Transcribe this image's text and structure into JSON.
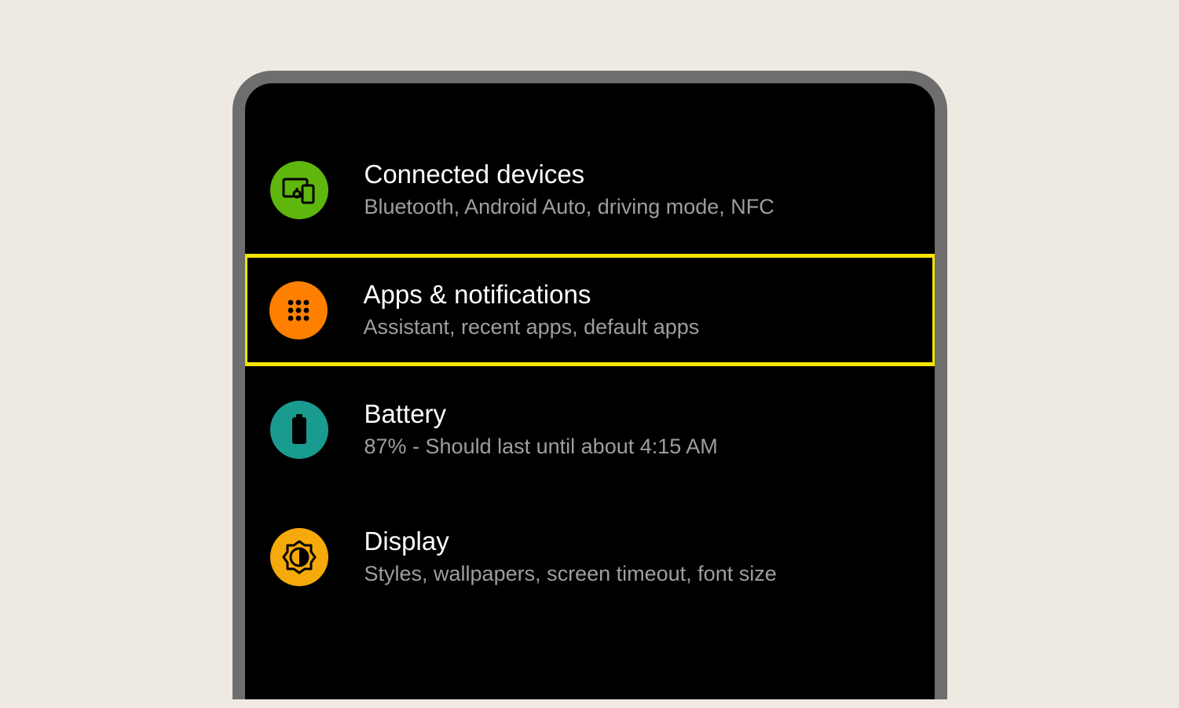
{
  "settings": {
    "items": [
      {
        "key": "connected",
        "title": "Connected devices",
        "subtitle": "Bluetooth, Android Auto, driving mode, NFC",
        "icon": "devices-icon",
        "icon_class": "ic-connected",
        "highlight": false
      },
      {
        "key": "apps",
        "title": "Apps & notifications",
        "subtitle": "Assistant, recent apps, default apps",
        "icon": "apps-grid-icon",
        "icon_class": "ic-apps",
        "highlight": true
      },
      {
        "key": "battery",
        "title": "Battery",
        "subtitle": "87% - Should last until about 4:15 AM",
        "icon": "battery-icon",
        "icon_class": "ic-battery",
        "highlight": false
      },
      {
        "key": "display",
        "title": "Display",
        "subtitle": "Styles, wallpapers, screen timeout, font size",
        "icon": "brightness-icon",
        "icon_class": "ic-display",
        "highlight": false
      }
    ]
  },
  "colors": {
    "page_bg": "#eeeae1",
    "device_frame": "#6e6e6e",
    "device_bg": "#000000",
    "title_text": "#ffffff",
    "subtitle_text": "#9e9e9e",
    "highlight_border": "#f5e400",
    "icon_connected": "#5fb70e",
    "icon_apps": "#ff8000",
    "icon_battery": "#1a9b8f",
    "icon_display": "#f5a90a"
  }
}
